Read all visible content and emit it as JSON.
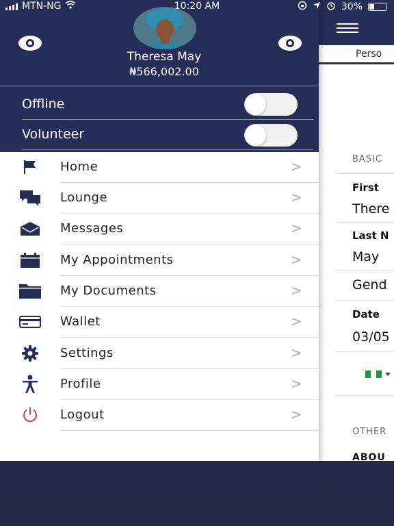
{
  "status_bar": {
    "carrier": "MTN-NG",
    "time": "10:20 AM",
    "battery_text": "30%",
    "battery_level": 0.3
  },
  "drawer": {
    "user_name": "Theresa May",
    "balance": "₦566,002.00",
    "toggles": [
      {
        "label": "Offline",
        "on": false
      },
      {
        "label": "Volunteer",
        "on": false
      }
    ],
    "menu": [
      {
        "label": "Home",
        "icon": "flag-icon"
      },
      {
        "label": "Lounge",
        "icon": "chat-bubbles-icon"
      },
      {
        "label": "Messages",
        "icon": "envelope-icon"
      },
      {
        "label": "My Appointments",
        "icon": "calendar-icon"
      },
      {
        "label": "My Documents",
        "icon": "folder-icon"
      },
      {
        "label": "Wallet",
        "icon": "card-icon"
      },
      {
        "label": "Settings",
        "icon": "gear-icon"
      },
      {
        "label": "Profile",
        "icon": "person-icon"
      },
      {
        "label": "Logout",
        "icon": "power-icon"
      }
    ],
    "chevron": ">"
  },
  "background_page": {
    "tab": "Perso",
    "section_basic": "BASIC",
    "first_label": "First",
    "first_value": "There",
    "last_label": "Last N",
    "last_value": "May",
    "gender_value": "Gend",
    "date_label": "Date",
    "date_value": "03/05",
    "section_other": "OTHER",
    "about_label": "ABOU"
  },
  "colors": {
    "header_navy": "#262e58",
    "page_background": "#262a48",
    "logout_red": "#c0392b"
  }
}
